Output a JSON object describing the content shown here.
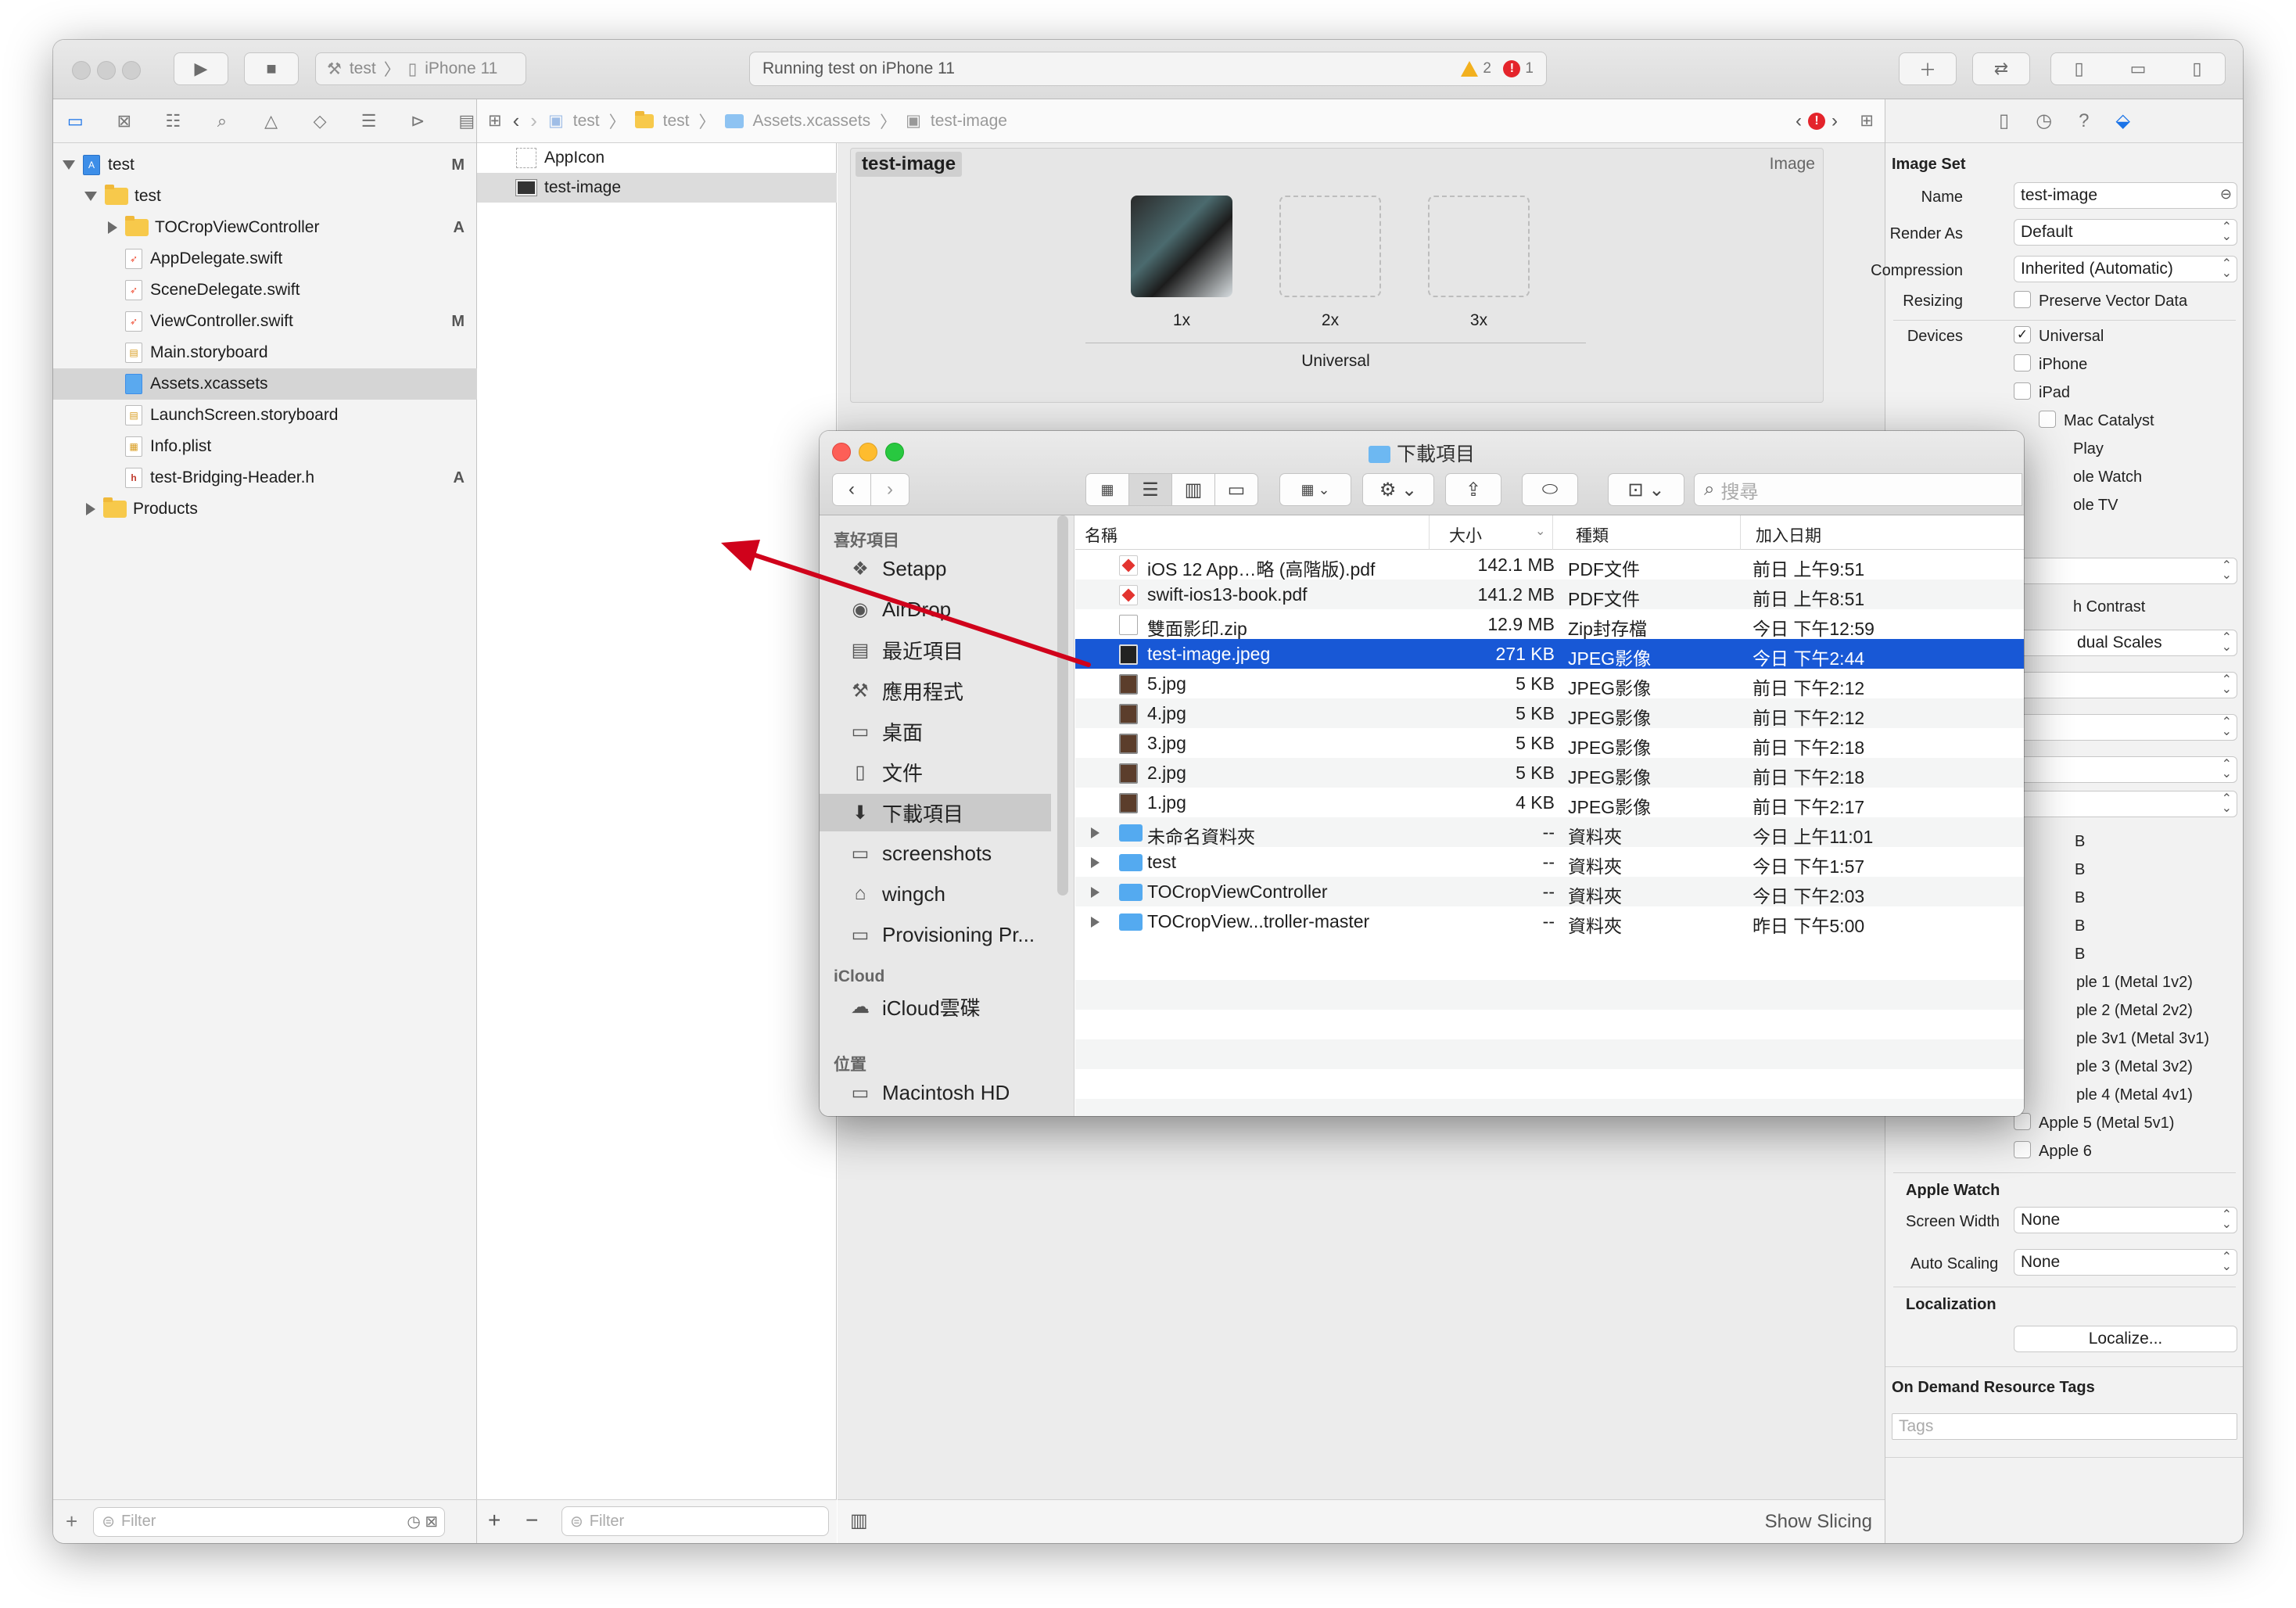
{
  "toolbar": {
    "scheme_name": "test",
    "device": "iPhone 11",
    "activity": "Running test on iPhone 11",
    "warnings": "2",
    "errors": "1"
  },
  "navigator": {
    "items": [
      {
        "label": "test",
        "status": "M"
      },
      {
        "label": "test",
        "status": ""
      },
      {
        "label": "TOCropViewController",
        "status": "A"
      },
      {
        "label": "AppDelegate.swift",
        "status": ""
      },
      {
        "label": "SceneDelegate.swift",
        "status": ""
      },
      {
        "label": "ViewController.swift",
        "status": "M"
      },
      {
        "label": "Main.storyboard",
        "status": ""
      },
      {
        "label": "Assets.xcassets",
        "status": ""
      },
      {
        "label": "LaunchScreen.storyboard",
        "status": ""
      },
      {
        "label": "Info.plist",
        "status": ""
      },
      {
        "label": "test-Bridging-Header.h",
        "status": "A"
      },
      {
        "label": "Products",
        "status": ""
      }
    ],
    "filter_placeholder": "Filter"
  },
  "jumpbar": {
    "crumbs": [
      "test",
      "test",
      "Assets.xcassets",
      "test-image"
    ]
  },
  "asset_list": {
    "items": [
      "AppIcon",
      "test-image"
    ],
    "filter_placeholder": "Filter"
  },
  "editor": {
    "set_name": "test-image",
    "kind": "Image",
    "slots": [
      "1x",
      "2x",
      "3x"
    ],
    "group": "Universal",
    "show_slicing": "Show Slicing"
  },
  "debug": {
    "target": "test"
  },
  "inspector": {
    "section": "Image Set",
    "name_label": "Name",
    "name_value": "test-image",
    "render_label": "Render As",
    "render_value": "Default",
    "compression_label": "Compression",
    "compression_value": "Inherited (Automatic)",
    "resizing_label": "Resizing",
    "resizing_value": "Preserve Vector Data",
    "devices_label": "Devices",
    "devices": [
      "Universal",
      "iPhone",
      "iPad",
      "Mac Catalyst"
    ],
    "partial": [
      "Play",
      "ole Watch",
      "ole TV",
      "h Contrast",
      "dual Scales"
    ],
    "bytes": [
      "B",
      "B",
      "B",
      "B",
      "B"
    ],
    "gpu": [
      "ple 1 (Metal 1v2)",
      "ple 2 (Metal 2v2)",
      "ple 3v1 (Metal 3v1)",
      "ple 3 (Metal 3v2)",
      "ple 4 (Metal 4v1)",
      "Apple 5 (Metal 5v1)",
      "Apple 6"
    ],
    "watch_section": "Apple Watch",
    "screen_width_label": "Screen Width",
    "screen_width_value": "None",
    "auto_scaling_label": "Auto Scaling",
    "auto_scaling_value": "None",
    "localization_section": "Localization",
    "localize_button": "Localize...",
    "odr_section": "On Demand Resource Tags",
    "tags_placeholder": "Tags"
  },
  "finder": {
    "title": "下載項目",
    "search_placeholder": "搜尋",
    "sidebar": {
      "favorites_header": "喜好項目",
      "favorites": [
        "Setapp",
        "AirDrop",
        "最近項目",
        "應用程式",
        "桌面",
        "文件",
        "下載項目",
        "screenshots",
        "wingch",
        "Provisioning Pr..."
      ],
      "icloud_header": "iCloud",
      "icloud": [
        "iCloud雲碟"
      ],
      "locations_header": "位置",
      "locations": [
        "Macintosh HD"
      ]
    },
    "columns": [
      "名稱",
      "大小",
      "種類",
      "加入日期"
    ],
    "files": [
      {
        "name": "iOS 12 App…略 (高階版).pdf",
        "size": "142.1 MB",
        "kind": "PDF文件",
        "date": "前日 上午9:51",
        "type": "pdf"
      },
      {
        "name": "swift-ios13-book.pdf",
        "size": "141.2 MB",
        "kind": "PDF文件",
        "date": "前日 上午8:51",
        "type": "pdf"
      },
      {
        "name": "雙面影印.zip",
        "size": "12.9 MB",
        "kind": "Zip封存檔",
        "date": "今日 下午12:59",
        "type": "zip"
      },
      {
        "name": "test-image.jpeg",
        "size": "271 KB",
        "kind": "JPEG影像",
        "date": "今日 下午2:44",
        "type": "jpeg"
      },
      {
        "name": "5.jpg",
        "size": "5 KB",
        "kind": "JPEG影像",
        "date": "前日 下午2:12",
        "type": "img"
      },
      {
        "name": "4.jpg",
        "size": "5 KB",
        "kind": "JPEG影像",
        "date": "前日 下午2:12",
        "type": "img"
      },
      {
        "name": "3.jpg",
        "size": "5 KB",
        "kind": "JPEG影像",
        "date": "前日 下午2:18",
        "type": "img"
      },
      {
        "name": "2.jpg",
        "size": "5 KB",
        "kind": "JPEG影像",
        "date": "前日 下午2:18",
        "type": "img"
      },
      {
        "name": "1.jpg",
        "size": "4 KB",
        "kind": "JPEG影像",
        "date": "前日 下午2:17",
        "type": "img"
      },
      {
        "name": "未命名資料夾",
        "size": "--",
        "kind": "資料夾",
        "date": "今日 上午11:01",
        "type": "folder"
      },
      {
        "name": "test",
        "size": "--",
        "kind": "資料夾",
        "date": "今日 下午1:57",
        "type": "folder"
      },
      {
        "name": "TOCropViewController",
        "size": "--",
        "kind": "資料夾",
        "date": "今日 下午2:03",
        "type": "folder"
      },
      {
        "name": "TOCropView...troller-master",
        "size": "--",
        "kind": "資料夾",
        "date": "昨日 下午5:00",
        "type": "folder"
      }
    ]
  },
  "colors": {
    "selection": "#1858d6",
    "arrow": "#d0021b",
    "accent": "#1a73e8"
  }
}
